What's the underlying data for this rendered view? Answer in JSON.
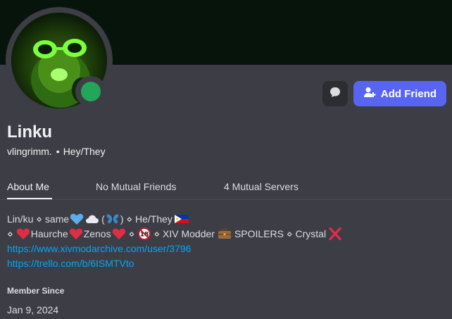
{
  "profile": {
    "display_name": "Linku",
    "username": "vlingrimm.",
    "separator": "•",
    "pronouns": "Hey/They",
    "status": "online"
  },
  "actions": {
    "message_icon": "chat-bubble-icon",
    "add_friend_label": "Add Friend",
    "add_friend_icon": "add-user-icon"
  },
  "tabs": [
    {
      "label": "About Me",
      "active": true
    },
    {
      "label": "No Mutual Friends",
      "active": false
    },
    {
      "label": "4 Mutual Servers",
      "active": false
    }
  ],
  "bio": {
    "line1": {
      "a": "Lin/ku ⋄ same",
      "b": "(",
      "c": ") ⋄ He/They",
      "emojis": [
        "blue-heart",
        "cloud",
        "butterfly",
        "philippines-flag"
      ]
    },
    "line2": {
      "a": "⋄",
      "b": "Haurche",
      "c": "Zenos",
      "d": "⋄",
      "e": "⋄ XIV Modder",
      "f": "SPOILERS ⋄ Crystal",
      "emojis": [
        "red-heart",
        "red-heart",
        "red-heart",
        "no-one-under-18",
        "briefcase",
        "cross-mark"
      ]
    },
    "links": [
      "https://www.xivmodarchive.com/user/3796",
      "https://trello.com/b/6ISMTVto"
    ]
  },
  "member_since": {
    "label": "Member Since",
    "date": "Jan 9, 2024"
  },
  "colors": {
    "banner": "#07140c",
    "panel": "#3d3d45",
    "accent": "#5865f2",
    "online": "#23a55a",
    "link": "#00a8fc"
  }
}
